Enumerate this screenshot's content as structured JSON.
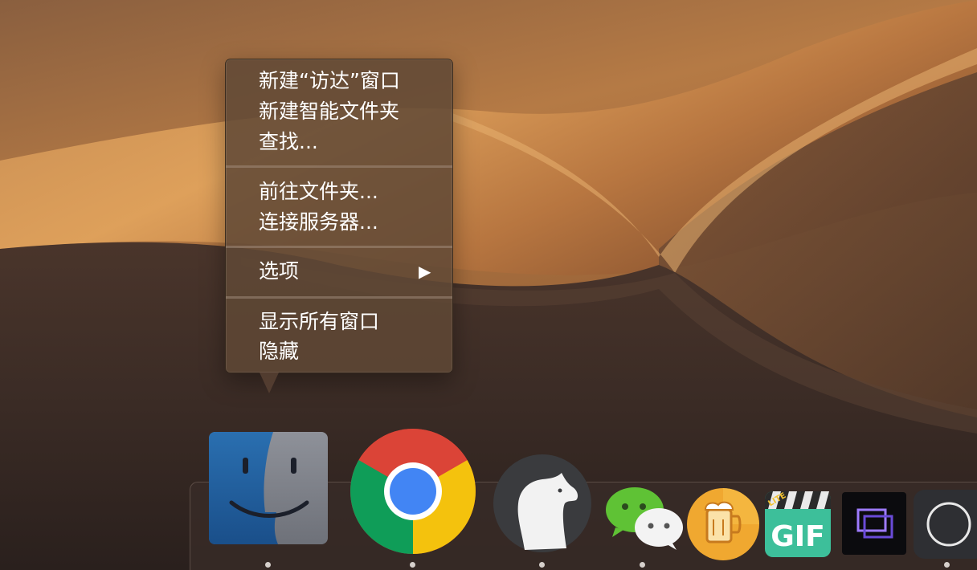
{
  "context_menu": {
    "sections": [
      {
        "items": [
          {
            "label": "新建“访达”窗口"
          },
          {
            "label": "新建智能文件夹"
          },
          {
            "label": "查找..."
          }
        ]
      },
      {
        "items": [
          {
            "label": "前往文件夹..."
          },
          {
            "label": "连接服务器..."
          }
        ]
      },
      {
        "items": [
          {
            "label": "选项",
            "submenu_indicator": "▶"
          }
        ]
      },
      {
        "items": [
          {
            "label": "显示所有窗口"
          },
          {
            "label": "隐藏"
          }
        ]
      }
    ]
  },
  "dock": {
    "apps": [
      {
        "icon": "finder-icon",
        "running": true
      },
      {
        "icon": "chrome-icon",
        "running": true
      },
      {
        "icon": "bear-icon",
        "running": true
      },
      {
        "icon": "wechat-icon",
        "running": true
      },
      {
        "icon": "beer-app-icon",
        "running": false
      },
      {
        "icon": "gif-lite-icon",
        "running": false,
        "badge_text": "LITE",
        "label_text": "GIF"
      },
      {
        "icon": "screen-app-icon",
        "running": false
      },
      {
        "icon": "circle-app-icon",
        "running": true
      }
    ]
  },
  "colors": {
    "menu_bg": "#604836",
    "menu_text": "#ffffff",
    "wallpaper_sand": "#c78a4e",
    "wallpaper_shadow": "#2e2421"
  }
}
